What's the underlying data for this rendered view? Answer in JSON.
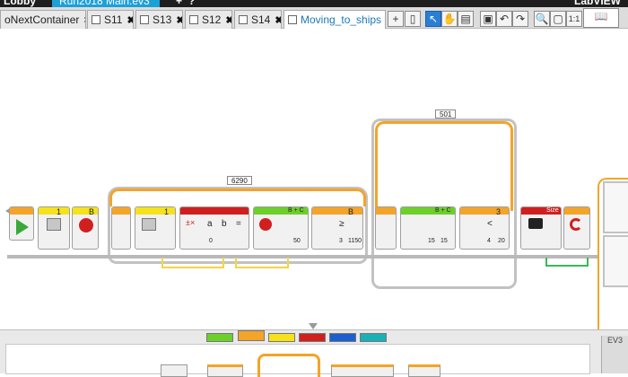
{
  "titlebar": {
    "left_label": "Lobby",
    "active_project": "Run2018 Main.ev3",
    "add_label": "+",
    "help_label": "?",
    "right_label": "LabVIEW"
  },
  "tabs": [
    {
      "label": "oNextContainer",
      "close": "✖"
    },
    {
      "label": "S11",
      "close": "✖"
    },
    {
      "label": "S13",
      "close": "✖"
    },
    {
      "label": "S12",
      "close": "✖"
    },
    {
      "label": "S14",
      "close": "✖"
    },
    {
      "label": "Moving_to_ships",
      "close": "✖"
    }
  ],
  "toolbar": {
    "add": "+",
    "new_comment": "▯",
    "pointer": "↖",
    "pan": "✋",
    "comment": "▤",
    "save": "▣",
    "undo": "↶",
    "redo": "↷",
    "zoom_in": "🔍",
    "zoom_out": "▢",
    "zoom_reset": "1:1",
    "content_editor": "📖"
  },
  "program": {
    "loop1_count": "6290",
    "loop2_count": "501",
    "block_values": {
      "b2_port": "1",
      "b3_port": "B",
      "b5_port": "1",
      "b7_var_a": "a",
      "b7_var_b": "b",
      "b7_op": "=",
      "b7_value": "0",
      "b8_ports": "B + C",
      "b8_speed": "50",
      "b9_port": "B",
      "b9_op": "≥",
      "b9_value1": "3",
      "b9_value2": "1150",
      "b11_ports": "B + C",
      "b11_v1": "15",
      "b11_v2": "15",
      "b12_port": "3",
      "b12_op": "<",
      "b12_v1": "4",
      "b12_v2": "20",
      "b14_label": "Size"
    }
  },
  "palette": {
    "colors": [
      "#6ccf2a",
      "#f4a428",
      "#f6e21b",
      "#d11f1f",
      "#1d5fcf",
      "#1ab0b8"
    ],
    "ev3_label": "EV3"
  }
}
